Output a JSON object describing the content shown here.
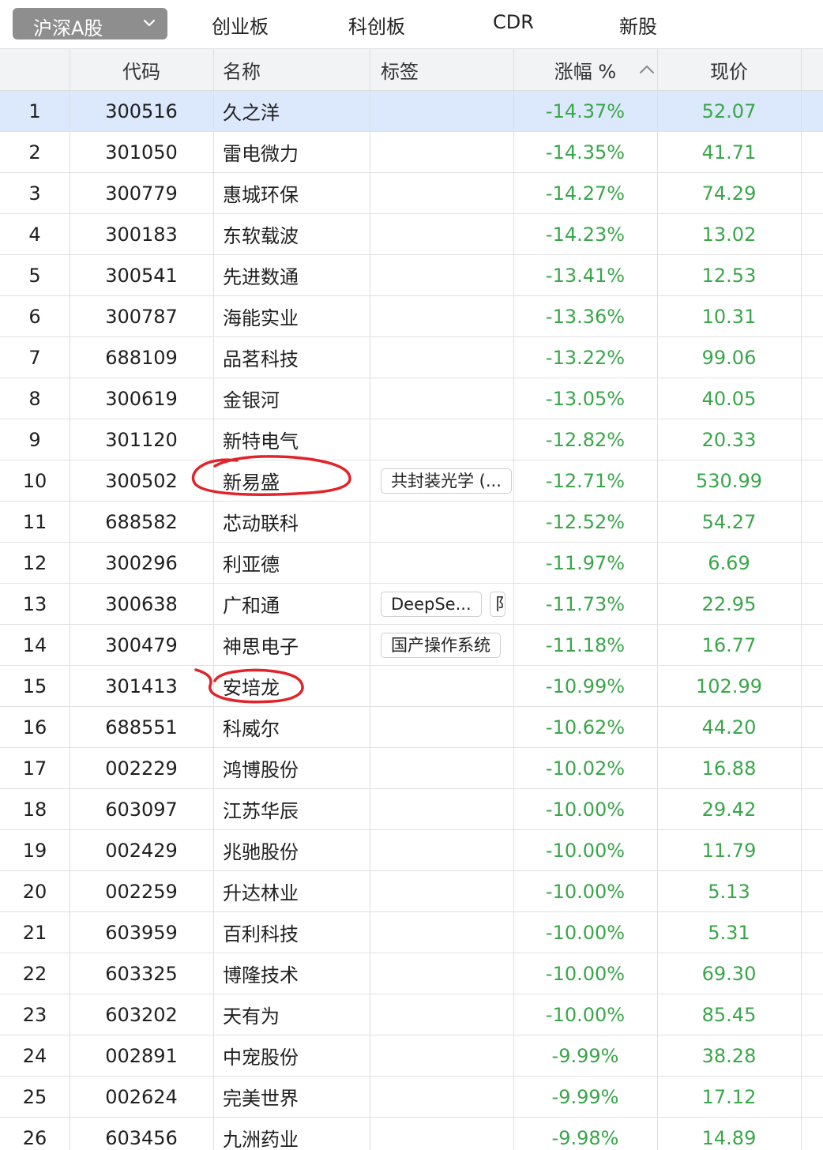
{
  "tabs": {
    "selected_market": "沪深A股",
    "items": [
      "创业板",
      "科创板",
      "CDR",
      "新股"
    ]
  },
  "columns": {
    "code": "代码",
    "name": "名称",
    "tag": "标签",
    "change": "涨幅 %",
    "price": "现价"
  },
  "rows": [
    {
      "idx": "1",
      "code": "300516",
      "name": "久之洋",
      "tags": [],
      "change": "-14.37%",
      "price": "52.07",
      "selected": true
    },
    {
      "idx": "2",
      "code": "301050",
      "name": "雷电微力",
      "tags": [],
      "change": "-14.35%",
      "price": "41.71"
    },
    {
      "idx": "3",
      "code": "300779",
      "name": "惠城环保",
      "tags": [],
      "change": "-14.27%",
      "price": "74.29"
    },
    {
      "idx": "4",
      "code": "300183",
      "name": "东软载波",
      "tags": [],
      "change": "-14.23%",
      "price": "13.02"
    },
    {
      "idx": "5",
      "code": "300541",
      "name": "先进数通",
      "tags": [],
      "change": "-13.41%",
      "price": "12.53"
    },
    {
      "idx": "6",
      "code": "300787",
      "name": "海能实业",
      "tags": [],
      "change": "-13.36%",
      "price": "10.31"
    },
    {
      "idx": "7",
      "code": "688109",
      "name": "品茗科技",
      "tags": [],
      "change": "-13.22%",
      "price": "99.06"
    },
    {
      "idx": "8",
      "code": "300619",
      "name": "金银河",
      "tags": [],
      "change": "-13.05%",
      "price": "40.05"
    },
    {
      "idx": "9",
      "code": "301120",
      "name": "新特电气",
      "tags": [],
      "change": "-12.82%",
      "price": "20.33"
    },
    {
      "idx": "10",
      "code": "300502",
      "name": "新易盛",
      "tags": [
        "共封装光学 (..."
      ],
      "change": "-12.71%",
      "price": "530.99"
    },
    {
      "idx": "11",
      "code": "688582",
      "name": "芯动联科",
      "tags": [],
      "change": "-12.52%",
      "price": "54.27"
    },
    {
      "idx": "12",
      "code": "300296",
      "name": "利亚德",
      "tags": [],
      "change": "-11.97%",
      "price": "6.69"
    },
    {
      "idx": "13",
      "code": "300638",
      "name": "广和通",
      "tags": [
        "DeepSe...",
        "阝"
      ],
      "change": "-11.73%",
      "price": "22.95"
    },
    {
      "idx": "14",
      "code": "300479",
      "name": "神思电子",
      "tags": [
        "国产操作系统"
      ],
      "change": "-11.18%",
      "price": "16.77"
    },
    {
      "idx": "15",
      "code": "301413",
      "name": "安培龙",
      "tags": [],
      "change": "-10.99%",
      "price": "102.99"
    },
    {
      "idx": "16",
      "code": "688551",
      "name": "科威尔",
      "tags": [],
      "change": "-10.62%",
      "price": "44.20"
    },
    {
      "idx": "17",
      "code": "002229",
      "name": "鸿博股份",
      "tags": [],
      "change": "-10.02%",
      "price": "16.88"
    },
    {
      "idx": "18",
      "code": "603097",
      "name": "江苏华辰",
      "tags": [],
      "change": "-10.00%",
      "price": "29.42"
    },
    {
      "idx": "19",
      "code": "002429",
      "name": "兆驰股份",
      "tags": [],
      "change": "-10.00%",
      "price": "11.79"
    },
    {
      "idx": "20",
      "code": "002259",
      "name": "升达林业",
      "tags": [],
      "change": "-10.00%",
      "price": "5.13"
    },
    {
      "idx": "21",
      "code": "603959",
      "name": "百利科技",
      "tags": [],
      "change": "-10.00%",
      "price": "5.31"
    },
    {
      "idx": "22",
      "code": "603325",
      "name": "博隆技术",
      "tags": [],
      "change": "-10.00%",
      "price": "69.30"
    },
    {
      "idx": "23",
      "code": "603202",
      "name": "天有为",
      "tags": [],
      "change": "-10.00%",
      "price": "85.45"
    },
    {
      "idx": "24",
      "code": "002891",
      "name": "中宠股份",
      "tags": [],
      "change": "-9.99%",
      "price": "38.28"
    },
    {
      "idx": "25",
      "code": "002624",
      "name": "完美世界",
      "tags": [],
      "change": "-9.99%",
      "price": "17.12"
    },
    {
      "idx": "26",
      "code": "603456",
      "name": "九洲药业",
      "tags": [],
      "change": "-9.98%",
      "price": "14.89"
    }
  ],
  "colors": {
    "down_green": "#3aa64a",
    "selected_row": "#dce8fb",
    "header_bg": "#f2f3f5",
    "annotation_red": "#e0242a"
  },
  "icons": {
    "market_dropdown": "chevron-down-icon",
    "sort_indicator": "sort-asc-icon"
  }
}
